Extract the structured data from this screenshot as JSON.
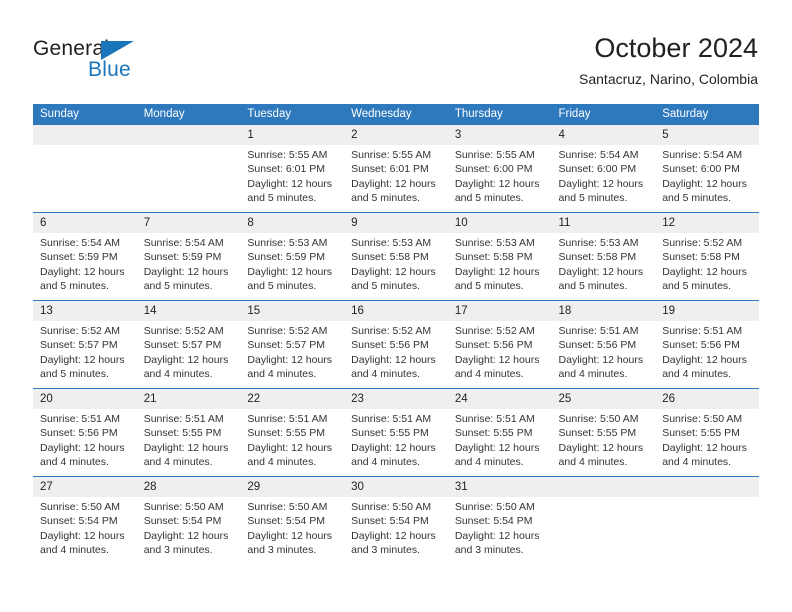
{
  "brand": {
    "name_line1": "General",
    "name_line2": "Blue",
    "color_dark": "#231f20",
    "color_blue": "#1b75bb"
  },
  "header": {
    "title": "October 2024",
    "subtitle": "Santacruz, Narino, Colombia"
  },
  "theme": {
    "header_blue": "#2e79bd",
    "daynum_band": "#efefef",
    "text": "#333333"
  },
  "weekday_headers": [
    "Sunday",
    "Monday",
    "Tuesday",
    "Wednesday",
    "Thursday",
    "Friday",
    "Saturday"
  ],
  "labels": {
    "sunrise_prefix": "Sunrise:",
    "sunset_prefix": "Sunset:",
    "daylight_prefix": "Daylight:"
  },
  "weeks": [
    [
      {
        "day": "",
        "sunrise": "",
        "sunset": "",
        "daylight_1": "",
        "daylight_2": ""
      },
      {
        "day": "",
        "sunrise": "",
        "sunset": "",
        "daylight_1": "",
        "daylight_2": ""
      },
      {
        "day": "1",
        "sunrise": "Sunrise: 5:55 AM",
        "sunset": "Sunset: 6:01 PM",
        "daylight_1": "Daylight: 12 hours",
        "daylight_2": "and 5 minutes."
      },
      {
        "day": "2",
        "sunrise": "Sunrise: 5:55 AM",
        "sunset": "Sunset: 6:01 PM",
        "daylight_1": "Daylight: 12 hours",
        "daylight_2": "and 5 minutes."
      },
      {
        "day": "3",
        "sunrise": "Sunrise: 5:55 AM",
        "sunset": "Sunset: 6:00 PM",
        "daylight_1": "Daylight: 12 hours",
        "daylight_2": "and 5 minutes."
      },
      {
        "day": "4",
        "sunrise": "Sunrise: 5:54 AM",
        "sunset": "Sunset: 6:00 PM",
        "daylight_1": "Daylight: 12 hours",
        "daylight_2": "and 5 minutes."
      },
      {
        "day": "5",
        "sunrise": "Sunrise: 5:54 AM",
        "sunset": "Sunset: 6:00 PM",
        "daylight_1": "Daylight: 12 hours",
        "daylight_2": "and 5 minutes."
      }
    ],
    [
      {
        "day": "6",
        "sunrise": "Sunrise: 5:54 AM",
        "sunset": "Sunset: 5:59 PM",
        "daylight_1": "Daylight: 12 hours",
        "daylight_2": "and 5 minutes."
      },
      {
        "day": "7",
        "sunrise": "Sunrise: 5:54 AM",
        "sunset": "Sunset: 5:59 PM",
        "daylight_1": "Daylight: 12 hours",
        "daylight_2": "and 5 minutes."
      },
      {
        "day": "8",
        "sunrise": "Sunrise: 5:53 AM",
        "sunset": "Sunset: 5:59 PM",
        "daylight_1": "Daylight: 12 hours",
        "daylight_2": "and 5 minutes."
      },
      {
        "day": "9",
        "sunrise": "Sunrise: 5:53 AM",
        "sunset": "Sunset: 5:58 PM",
        "daylight_1": "Daylight: 12 hours",
        "daylight_2": "and 5 minutes."
      },
      {
        "day": "10",
        "sunrise": "Sunrise: 5:53 AM",
        "sunset": "Sunset: 5:58 PM",
        "daylight_1": "Daylight: 12 hours",
        "daylight_2": "and 5 minutes."
      },
      {
        "day": "11",
        "sunrise": "Sunrise: 5:53 AM",
        "sunset": "Sunset: 5:58 PM",
        "daylight_1": "Daylight: 12 hours",
        "daylight_2": "and 5 minutes."
      },
      {
        "day": "12",
        "sunrise": "Sunrise: 5:52 AM",
        "sunset": "Sunset: 5:58 PM",
        "daylight_1": "Daylight: 12 hours",
        "daylight_2": "and 5 minutes."
      }
    ],
    [
      {
        "day": "13",
        "sunrise": "Sunrise: 5:52 AM",
        "sunset": "Sunset: 5:57 PM",
        "daylight_1": "Daylight: 12 hours",
        "daylight_2": "and 5 minutes."
      },
      {
        "day": "14",
        "sunrise": "Sunrise: 5:52 AM",
        "sunset": "Sunset: 5:57 PM",
        "daylight_1": "Daylight: 12 hours",
        "daylight_2": "and 4 minutes."
      },
      {
        "day": "15",
        "sunrise": "Sunrise: 5:52 AM",
        "sunset": "Sunset: 5:57 PM",
        "daylight_1": "Daylight: 12 hours",
        "daylight_2": "and 4 minutes."
      },
      {
        "day": "16",
        "sunrise": "Sunrise: 5:52 AM",
        "sunset": "Sunset: 5:56 PM",
        "daylight_1": "Daylight: 12 hours",
        "daylight_2": "and 4 minutes."
      },
      {
        "day": "17",
        "sunrise": "Sunrise: 5:52 AM",
        "sunset": "Sunset: 5:56 PM",
        "daylight_1": "Daylight: 12 hours",
        "daylight_2": "and 4 minutes."
      },
      {
        "day": "18",
        "sunrise": "Sunrise: 5:51 AM",
        "sunset": "Sunset: 5:56 PM",
        "daylight_1": "Daylight: 12 hours",
        "daylight_2": "and 4 minutes."
      },
      {
        "day": "19",
        "sunrise": "Sunrise: 5:51 AM",
        "sunset": "Sunset: 5:56 PM",
        "daylight_1": "Daylight: 12 hours",
        "daylight_2": "and 4 minutes."
      }
    ],
    [
      {
        "day": "20",
        "sunrise": "Sunrise: 5:51 AM",
        "sunset": "Sunset: 5:56 PM",
        "daylight_1": "Daylight: 12 hours",
        "daylight_2": "and 4 minutes."
      },
      {
        "day": "21",
        "sunrise": "Sunrise: 5:51 AM",
        "sunset": "Sunset: 5:55 PM",
        "daylight_1": "Daylight: 12 hours",
        "daylight_2": "and 4 minutes."
      },
      {
        "day": "22",
        "sunrise": "Sunrise: 5:51 AM",
        "sunset": "Sunset: 5:55 PM",
        "daylight_1": "Daylight: 12 hours",
        "daylight_2": "and 4 minutes."
      },
      {
        "day": "23",
        "sunrise": "Sunrise: 5:51 AM",
        "sunset": "Sunset: 5:55 PM",
        "daylight_1": "Daylight: 12 hours",
        "daylight_2": "and 4 minutes."
      },
      {
        "day": "24",
        "sunrise": "Sunrise: 5:51 AM",
        "sunset": "Sunset: 5:55 PM",
        "daylight_1": "Daylight: 12 hours",
        "daylight_2": "and 4 minutes."
      },
      {
        "day": "25",
        "sunrise": "Sunrise: 5:50 AM",
        "sunset": "Sunset: 5:55 PM",
        "daylight_1": "Daylight: 12 hours",
        "daylight_2": "and 4 minutes."
      },
      {
        "day": "26",
        "sunrise": "Sunrise: 5:50 AM",
        "sunset": "Sunset: 5:55 PM",
        "daylight_1": "Daylight: 12 hours",
        "daylight_2": "and 4 minutes."
      }
    ],
    [
      {
        "day": "27",
        "sunrise": "Sunrise: 5:50 AM",
        "sunset": "Sunset: 5:54 PM",
        "daylight_1": "Daylight: 12 hours",
        "daylight_2": "and 4 minutes."
      },
      {
        "day": "28",
        "sunrise": "Sunrise: 5:50 AM",
        "sunset": "Sunset: 5:54 PM",
        "daylight_1": "Daylight: 12 hours",
        "daylight_2": "and 3 minutes."
      },
      {
        "day": "29",
        "sunrise": "Sunrise: 5:50 AM",
        "sunset": "Sunset: 5:54 PM",
        "daylight_1": "Daylight: 12 hours",
        "daylight_2": "and 3 minutes."
      },
      {
        "day": "30",
        "sunrise": "Sunrise: 5:50 AM",
        "sunset": "Sunset: 5:54 PM",
        "daylight_1": "Daylight: 12 hours",
        "daylight_2": "and 3 minutes."
      },
      {
        "day": "31",
        "sunrise": "Sunrise: 5:50 AM",
        "sunset": "Sunset: 5:54 PM",
        "daylight_1": "Daylight: 12 hours",
        "daylight_2": "and 3 minutes."
      },
      {
        "day": "",
        "sunrise": "",
        "sunset": "",
        "daylight_1": "",
        "daylight_2": ""
      },
      {
        "day": "",
        "sunrise": "",
        "sunset": "",
        "daylight_1": "",
        "daylight_2": ""
      }
    ]
  ]
}
